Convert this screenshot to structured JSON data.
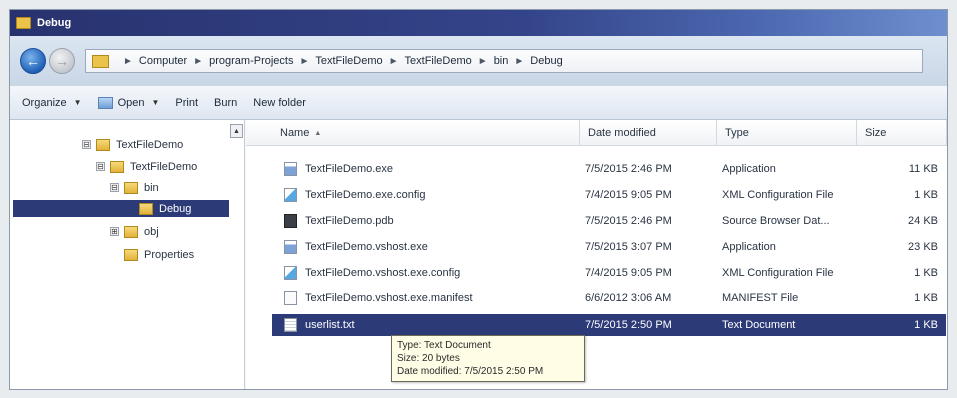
{
  "window": {
    "title": "Debug"
  },
  "breadcrumb": [
    "Computer",
    "program-Projects",
    "TextFileDemo",
    "TextFileDemo",
    "bin",
    "Debug"
  ],
  "toolbar": {
    "organize": "Organize",
    "open": "Open",
    "print": "Print",
    "burn": "Burn",
    "new_folder": "New folder"
  },
  "tree": {
    "nodes": [
      {
        "label": "TextFileDemo",
        "expander": "⊟"
      },
      {
        "label": "TextFileDemo",
        "expander": "⊟"
      },
      {
        "label": "bin",
        "expander": "⊟"
      },
      {
        "label": "Debug",
        "expander": ""
      },
      {
        "label": "obj",
        "expander": "⊞"
      },
      {
        "label": "Properties",
        "expander": ""
      }
    ]
  },
  "columns": {
    "name": "Name",
    "date": "Date modified",
    "type": "Type",
    "size": "Size"
  },
  "files": [
    {
      "name": "TextFileDemo.exe",
      "date": "7/5/2015 2:46 PM",
      "type": "Application",
      "size": "11 KB",
      "icon": "exe-icon"
    },
    {
      "name": "TextFileDemo.exe.config",
      "date": "7/4/2015 9:05 PM",
      "type": "XML Configuration File",
      "size": "1 KB",
      "icon": "config-icon"
    },
    {
      "name": "TextFileDemo.pdb",
      "date": "7/5/2015 2:46 PM",
      "type": "Source Browser Dat...",
      "size": "24 KB",
      "icon": "pdb-icon"
    },
    {
      "name": "TextFileDemo.vshost.exe",
      "date": "7/5/2015 3:07 PM",
      "type": "Application",
      "size": "23 KB",
      "icon": "exe-icon"
    },
    {
      "name": "TextFileDemo.vshost.exe.config",
      "date": "7/4/2015 9:05 PM",
      "type": "XML Configuration File",
      "size": "1 KB",
      "icon": "config-icon"
    },
    {
      "name": "TextFileDemo.vshost.exe.manifest",
      "date": "6/6/2012 3:06 AM",
      "type": "MANIFEST File",
      "size": "1 KB",
      "icon": "manifest-icon"
    },
    {
      "name": "userlist.txt",
      "date": "7/5/2015 2:50 PM",
      "type": "Text Document",
      "size": "1 KB",
      "icon": "txt-icon"
    }
  ],
  "tooltip": {
    "type": "Type: Text Document",
    "size": "Size: 20 bytes",
    "date": "Date modified: 7/5/2015 2:50 PM"
  },
  "colors": {
    "selection": "#2c3a78",
    "titlebar": "#28326e",
    "folder": "#ecc34a",
    "tooltip_bg": "#fffde6"
  }
}
